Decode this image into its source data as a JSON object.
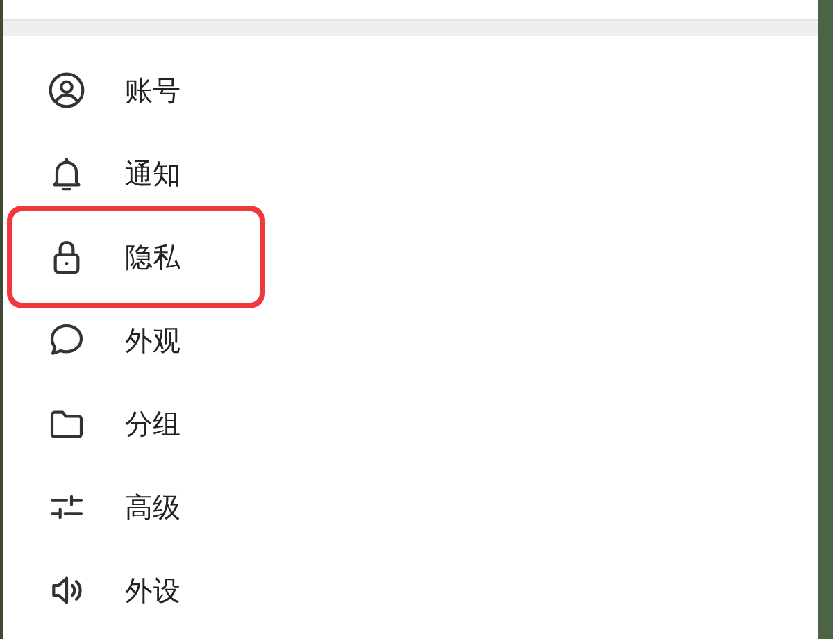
{
  "menu": {
    "items": [
      {
        "label": "账号",
        "selected": false
      },
      {
        "label": "通知",
        "selected": false
      },
      {
        "label": "隐私",
        "selected": true
      },
      {
        "label": "外观",
        "selected": false
      },
      {
        "label": "分组",
        "selected": false
      },
      {
        "label": "高级",
        "selected": false
      },
      {
        "label": "外设",
        "selected": false
      }
    ]
  }
}
